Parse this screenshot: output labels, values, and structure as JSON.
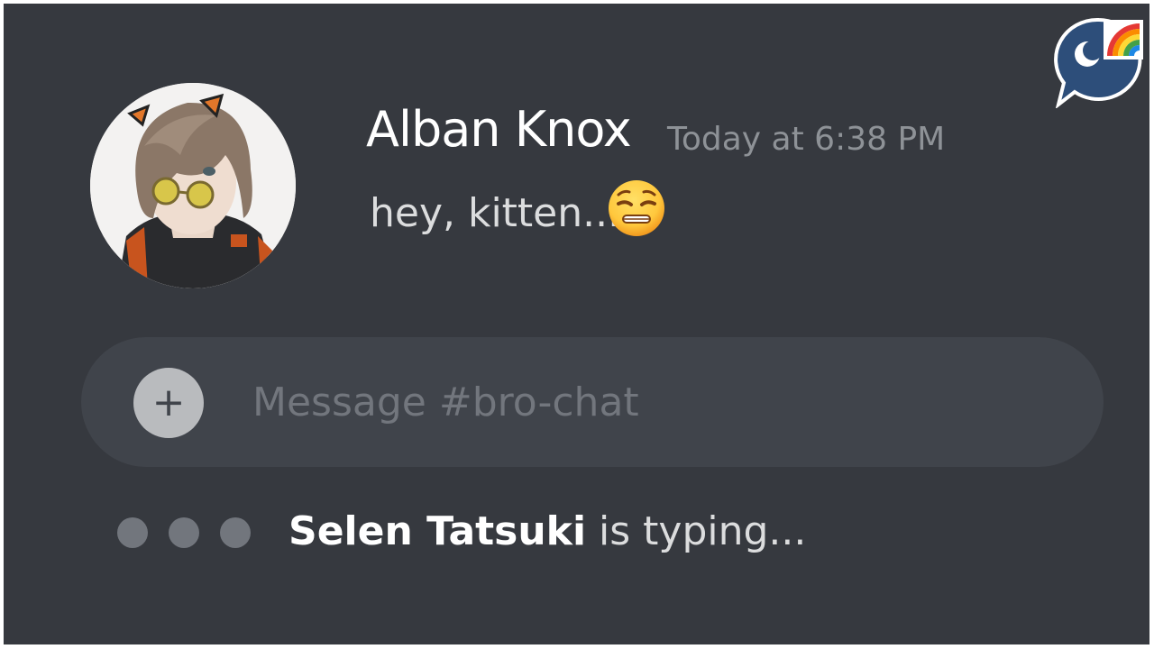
{
  "message": {
    "author": "Alban Knox",
    "timestamp": "Today at 6:38 PM",
    "text": "hey, kitten...",
    "emoji_icon": "weary-face-emoji-icon"
  },
  "composer": {
    "placeholder": "Message #bro-chat",
    "add_label": "+"
  },
  "typing_indicator": {
    "user": "Selen Tatsuki",
    "suffix": " is typing..."
  },
  "colors": {
    "background": "#36393f",
    "composer": "#40444b",
    "author": "#ffffff",
    "timestamp": "#8e9297",
    "placeholder": "#72767d"
  }
}
